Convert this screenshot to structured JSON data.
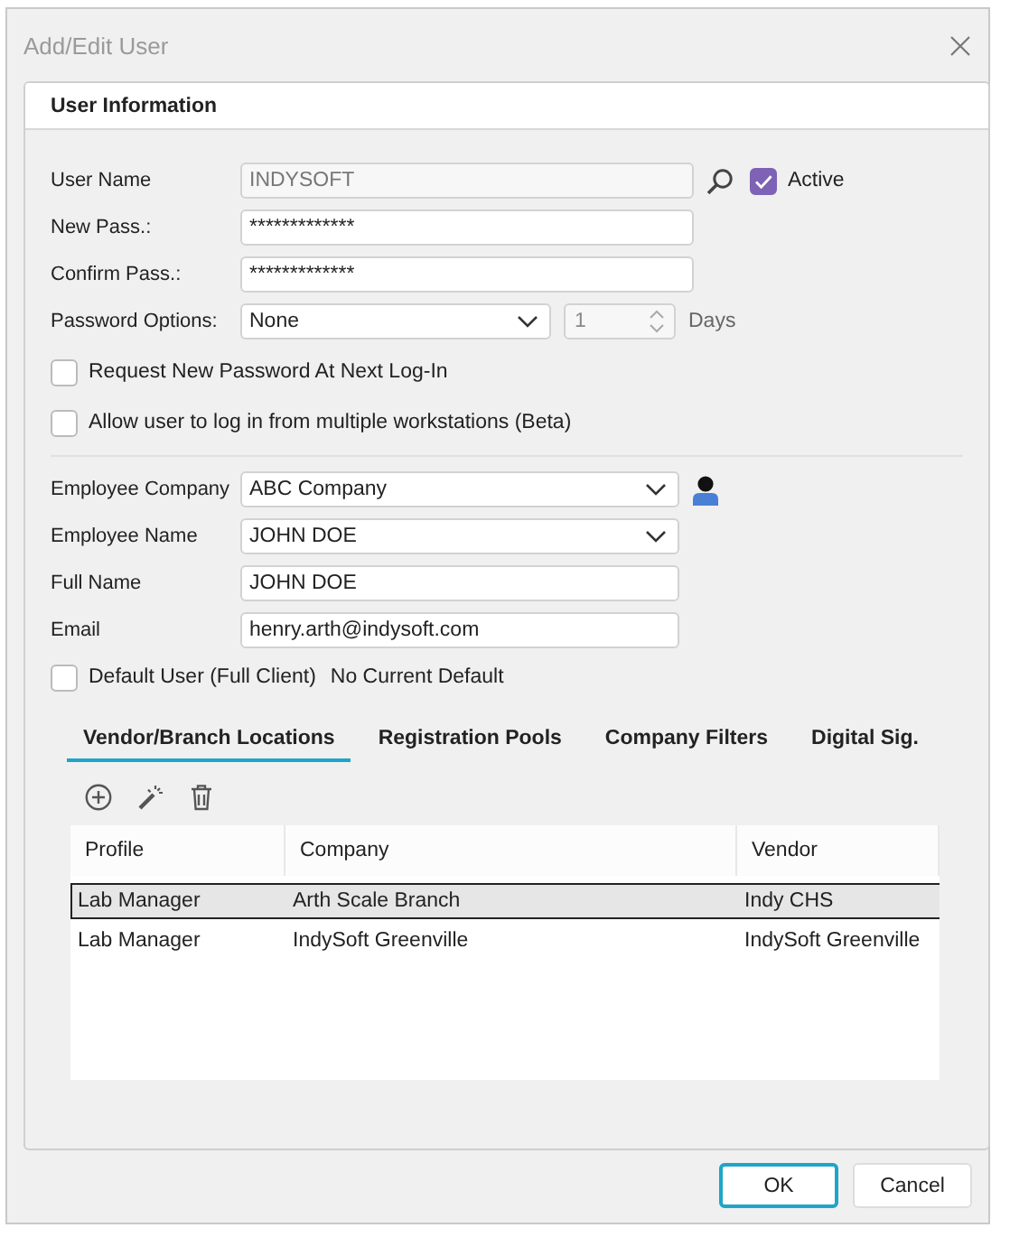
{
  "window": {
    "title": "Add/Edit User"
  },
  "section": {
    "title": "User Information"
  },
  "user_name": {
    "label": "User Name",
    "value": "INDYSOFT",
    "disabled": true
  },
  "active": {
    "label": "Active",
    "checked": true
  },
  "passwords": [
    {
      "label": "New Pass.:",
      "value": "*************"
    },
    {
      "label": "Confirm Pass.:",
      "value": "*************"
    }
  ],
  "password_options": {
    "label": "Password Options:",
    "value": "None",
    "days": {
      "value": "1",
      "disabled": true
    },
    "unit": "Days"
  },
  "options": [
    {
      "label": "Request New Password At Next Log-In",
      "checked": false
    },
    {
      "label": "Allow user to log in from multiple workstations (Beta)",
      "checked": false
    }
  ],
  "employee": [
    {
      "kind": "dropdown",
      "label": "Employee Company",
      "value": "ABC Company",
      "person_icon": true
    },
    {
      "kind": "dropdown",
      "label": "Employee Name",
      "value": "JOHN DOE"
    },
    {
      "kind": "text",
      "label": "Full Name",
      "value": "JOHN DOE"
    },
    {
      "kind": "text",
      "label": "Email",
      "value": "henry.arth@indysoft.com"
    }
  ],
  "default_user": {
    "label": "Default User (Full Client)",
    "checked": false,
    "status": "No Current Default"
  },
  "tabs": [
    {
      "label": "Vendor/Branch Locations",
      "selected": true
    },
    {
      "label": "Registration Pools",
      "selected": false
    },
    {
      "label": "Company Filters",
      "selected": false
    },
    {
      "label": "Digital Sig.",
      "selected": false
    }
  ],
  "table": {
    "columns": [
      "Profile",
      "Company",
      "Vendor"
    ],
    "rows": [
      {
        "cells": [
          "Lab Manager",
          "Arth Scale Branch",
          "Indy CHS"
        ],
        "selected": true
      },
      {
        "cells": [
          "Lab Manager",
          "IndySoft Greenville",
          "IndySoft Greenville"
        ],
        "selected": false
      }
    ]
  },
  "buttons": [
    {
      "label": "OK",
      "default": true
    },
    {
      "label": "Cancel",
      "default": false
    }
  ]
}
